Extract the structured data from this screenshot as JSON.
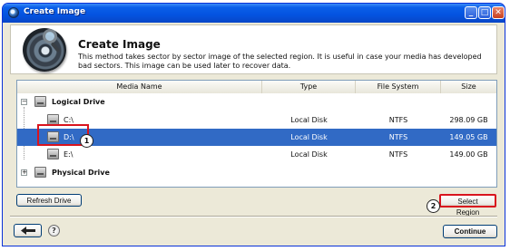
{
  "window": {
    "title": "Create Image",
    "minimize": "_",
    "maximize": "□",
    "close": "✕"
  },
  "header": {
    "title": "Create Image",
    "description": "This method takes sector by sector image of the selected region. It is useful in case your media has developed bad sectors. This image can be used later to recover data."
  },
  "table": {
    "columns": [
      "Media Name",
      "Type",
      "File System",
      "Size"
    ],
    "groups": [
      {
        "label": "Logical Drive",
        "expander": "−",
        "items": [
          {
            "name": "C:\\",
            "type": "Local Disk",
            "fs": "NTFS",
            "size": "298.09 GB"
          },
          {
            "name": "D:\\",
            "type": "Local Disk",
            "fs": "NTFS",
            "size": "149.05 GB"
          },
          {
            "name": "E:\\",
            "type": "Local Disk",
            "fs": "NTFS",
            "size": "149.00 GB"
          }
        ]
      },
      {
        "label": "Physical Drive",
        "expander": "+"
      }
    ]
  },
  "annotations": {
    "step1": "1",
    "step2": "2"
  },
  "buttons": {
    "refresh": "Refresh Drive",
    "select_region": "Select Region",
    "back_icon": "left-arrow-icon",
    "help": "?",
    "continue": "Continue"
  },
  "colors": {
    "selection": "#316ac5",
    "callout": "#d9141e",
    "titlebar": "#0453e0"
  }
}
